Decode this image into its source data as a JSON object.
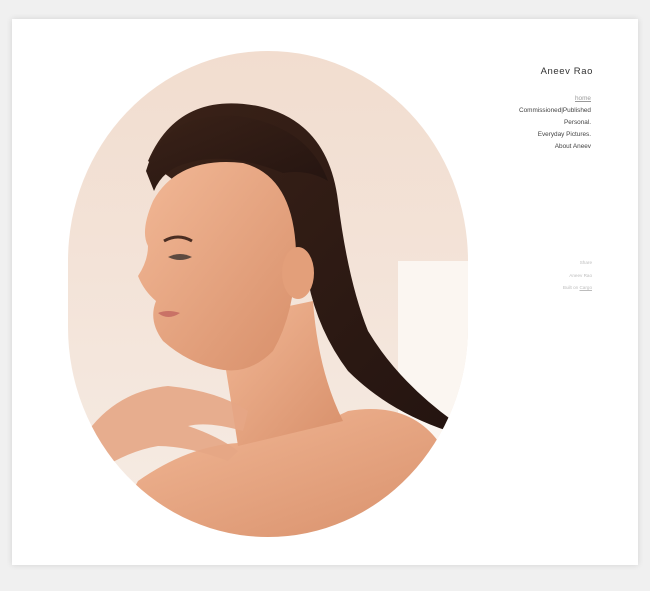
{
  "site": {
    "title": "Aneev Rao"
  },
  "nav": {
    "items": [
      {
        "label": "home",
        "active": true
      },
      {
        "label": "Commissioned|Published",
        "active": false
      },
      {
        "label": "Personal.",
        "active": false
      },
      {
        "label": "Everyday Pictures.",
        "active": false
      },
      {
        "label": "About Aneev",
        "active": false
      }
    ]
  },
  "footer": {
    "share": "Share",
    "copyright": "Aneev Rao",
    "built_prefix": "Built on ",
    "built_link": "Cargo"
  },
  "colors": {
    "background": "#f0f0f0",
    "card": "#ffffff",
    "title": "#333333",
    "nav_text": "#444444",
    "nav_active": "#9a9a9a",
    "footer_text": "#bdbdbd"
  },
  "media": {
    "hero_image": "portrait-photo"
  }
}
